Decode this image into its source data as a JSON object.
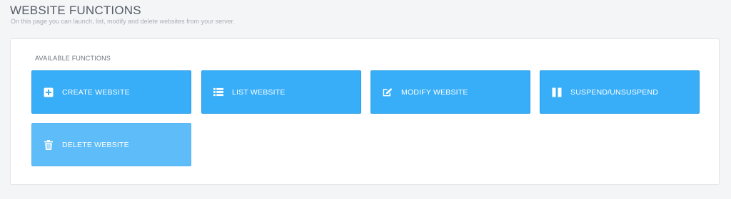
{
  "header": {
    "title": "WEBSITE FUNCTIONS",
    "subtitle": "On this page you can launch, list, modify and delete websites from your server."
  },
  "panel": {
    "section_label": "AVAILABLE FUNCTIONS",
    "buttons": [
      {
        "label": "CREATE WEBSITE",
        "icon": "plus-square-icon"
      },
      {
        "label": "LIST WEBSITE",
        "icon": "list-icon"
      },
      {
        "label": "MODIFY WEBSITE",
        "icon": "edit-icon"
      },
      {
        "label": "SUSPEND/UNSUSPEND",
        "icon": "pause-icon"
      },
      {
        "label": "DELETE WEBSITE",
        "icon": "trash-icon"
      }
    ]
  },
  "colors": {
    "accent": "#38aef8",
    "accent_light": "#5ebcf8",
    "background": "#f4f5f7"
  }
}
